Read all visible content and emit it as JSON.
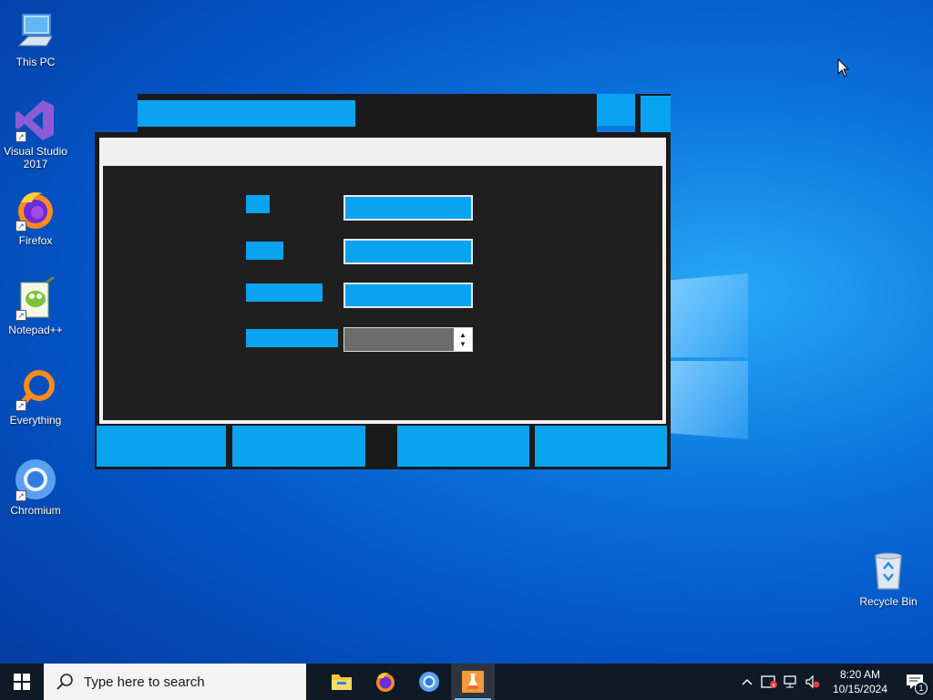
{
  "desktop": {
    "icons": [
      {
        "label": "This PC",
        "icon": "this-pc-icon"
      },
      {
        "label": "Visual Studio 2017",
        "icon": "visual-studio-icon"
      },
      {
        "label": "Firefox",
        "icon": "firefox-icon"
      },
      {
        "label": "Notepad++",
        "icon": "notepadpp-icon"
      },
      {
        "label": "Everything",
        "icon": "everything-icon"
      },
      {
        "label": "Chromium",
        "icon": "chromium-icon"
      },
      {
        "label": "Recycle Bin",
        "icon": "recycle-bin-icon"
      }
    ]
  },
  "app_window": {
    "labels": [
      "",
      "",
      "",
      ""
    ],
    "inputs": [
      "",
      "",
      ""
    ],
    "spin_value": "",
    "bottom_buttons": [
      "",
      "",
      "",
      ""
    ]
  },
  "taskbar": {
    "search_placeholder": "Type here to search",
    "apps": [
      {
        "icon": "file-explorer-icon",
        "active": false
      },
      {
        "icon": "firefox-icon",
        "active": false
      },
      {
        "icon": "chromium-icon",
        "active": false
      },
      {
        "icon": "flask-app-icon",
        "active": true
      }
    ],
    "clock": {
      "time": "8:20 AM",
      "date": "10/15/2024"
    },
    "notification_count": "1"
  },
  "colors": {
    "accent": "#0aa3f0",
    "window_bg": "#1f1f1f",
    "taskbar_bg": "#0f1a26"
  }
}
